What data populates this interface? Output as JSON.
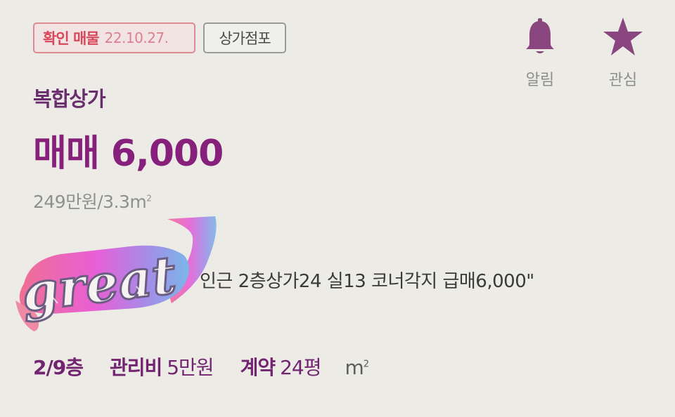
{
  "badges": {
    "verified_label": "확인 매물",
    "verified_date": "22.10.27.",
    "property_type": "상가점포"
  },
  "actions": {
    "alert_label": "알림",
    "favorite_label": "관심"
  },
  "listing": {
    "subtype": "복합상가",
    "price": "매매 6,000",
    "unit_price": "249만원/3.3",
    "unit_price_unit": "m",
    "unit_price_sup": "2",
    "description": "인근 2층상가24 실13 코너각지 급매6,000\""
  },
  "specs": {
    "floor": "2/9층",
    "mgmt_key": "관리비",
    "mgmt_value": "5만원",
    "contract_key": "계약",
    "contract_value": "24평",
    "area_unit": "m",
    "area_sup": "2"
  },
  "sticker": {
    "text": "great"
  },
  "colors": {
    "background": "#ecebe6",
    "brand_purple": "#86207b",
    "verified_red": "#d8485c",
    "icon_purple": "#8a467e"
  },
  "icons": {
    "alert": "bell-icon",
    "favorite": "star-icon"
  }
}
